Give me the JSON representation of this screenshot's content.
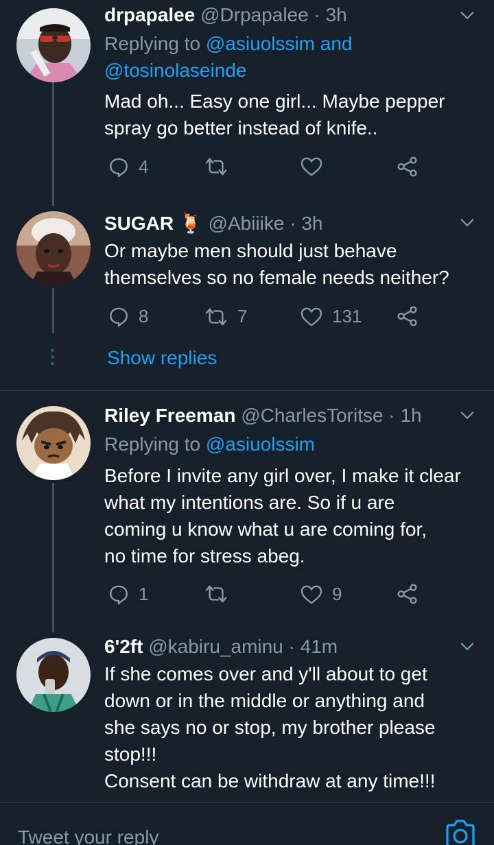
{
  "colors": {
    "background": "#15202b",
    "accent": "#1da1f2",
    "muted": "#8899a6",
    "divider": "#38444d"
  },
  "tweets": [
    {
      "name": "drpapalee",
      "handle": "@Drpapalee",
      "time": "· 3h",
      "replying_prefix": "Replying to ",
      "replying_mentions": "@asiuolssim and",
      "replying_mentions2": "@tosinolaseinde",
      "text_lines": [
        "Mad oh... Easy one girl... Maybe pepper",
        "spray go better instead of knife.."
      ],
      "replies": "4",
      "retweets": "",
      "likes": ""
    },
    {
      "name": "SUGAR",
      "emoji": "🍹",
      "handle": "@Abiiike",
      "time": "· 3h",
      "text_lines": [
        "Or maybe men should just behave",
        "themselves so no female needs neither?"
      ],
      "replies": "8",
      "retweets": "7",
      "likes": "131"
    },
    {
      "name": "Riley Freeman",
      "handle": "@CharlesToritse",
      "time": "· 1h",
      "replying_prefix": "Replying to ",
      "replying_mentions": "@asiuolssim",
      "text_lines": [
        "Before I invite any girl over, I make it clear",
        "what my intentions are. So if u are",
        "coming u know what u are coming for,",
        "no time for stress abeg."
      ],
      "replies": "1",
      "retweets": "",
      "likes": "9"
    },
    {
      "name": "6'2ft",
      "handle": "@kabiru_aminu",
      "time": "· 41m",
      "text_lines": [
        "If she comes over and y'll about to get",
        "down or in the middle or anything and",
        "she says no or stop, my brother please",
        "stop!!!",
        "Consent can be withdraw at any time!!!"
      ]
    }
  ],
  "show_replies": "Show replies",
  "reply_bar": {
    "placeholder": "Tweet your reply"
  },
  "icons": [
    "reply-icon",
    "retweet-icon",
    "like-icon",
    "share-icon",
    "chevron-down-icon",
    "camera-icon"
  ]
}
